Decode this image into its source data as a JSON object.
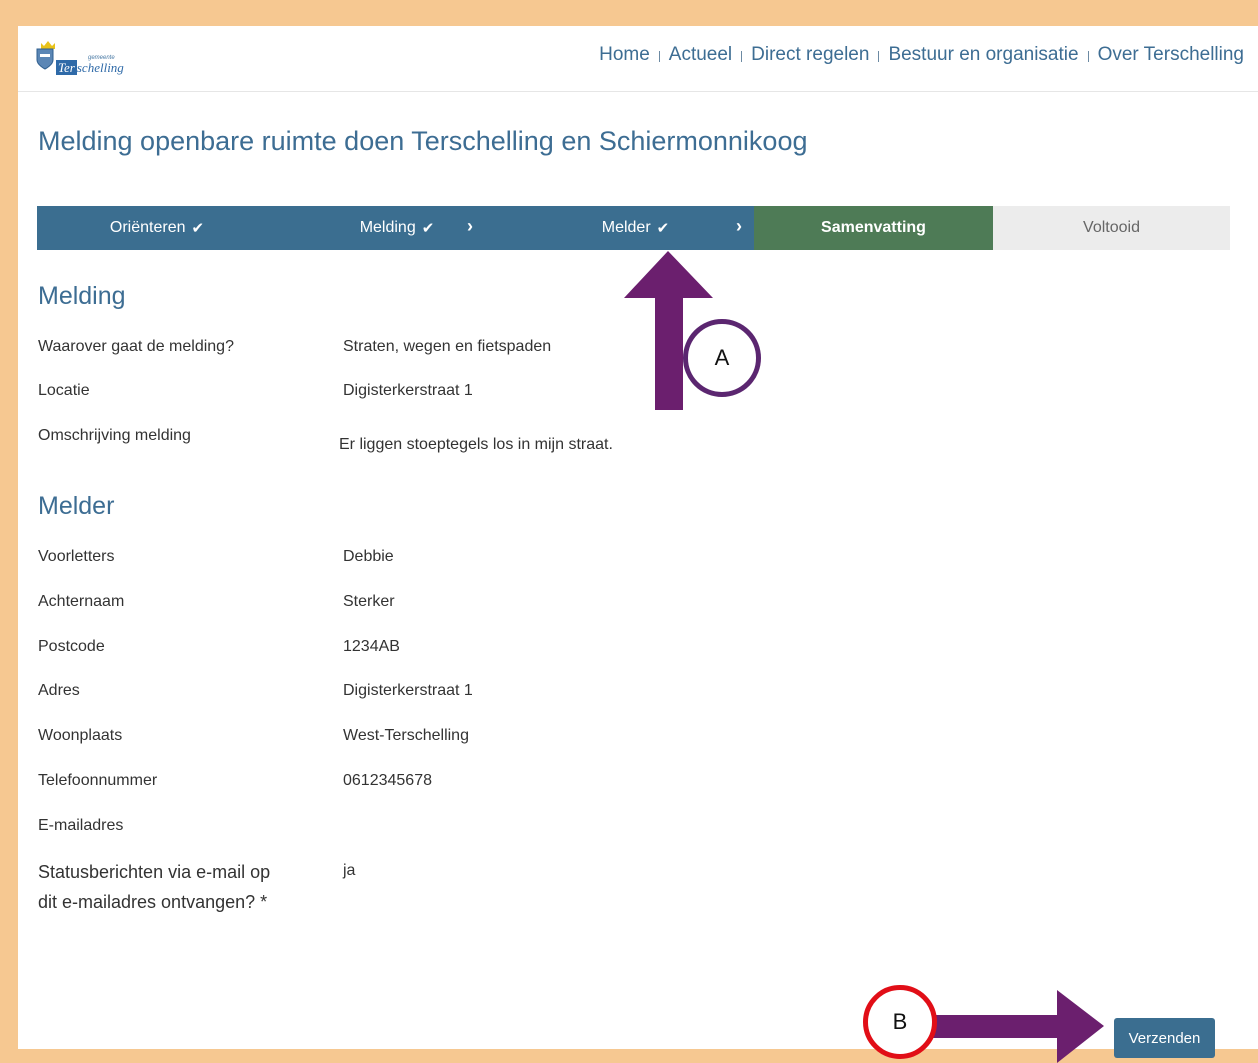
{
  "header": {
    "logo_small_text": "gemeente",
    "logo_ter": "Ter",
    "logo_rest": "schelling",
    "nav": [
      {
        "label": "Home"
      },
      {
        "label": "Actueel"
      },
      {
        "label": "Direct regelen"
      },
      {
        "label": "Bestuur en organisatie"
      },
      {
        "label": "Over Terschelling"
      }
    ]
  },
  "page_title": "Melding openbare ruimte doen Terschelling en Schiermonnikoog",
  "steps": [
    {
      "label": "Oriënteren",
      "state": "done",
      "check_icon": "✔"
    },
    {
      "label": "Melding",
      "state": "done",
      "check_icon": "✔",
      "chevron_icon": "›"
    },
    {
      "label": "Melder",
      "state": "done",
      "check_icon": "✔",
      "chevron_icon": "›"
    },
    {
      "label": "Samenvatting",
      "state": "active"
    },
    {
      "label": "Voltooid",
      "state": "todo"
    }
  ],
  "melding": {
    "title": "Melding",
    "rows": [
      {
        "label": "Waarover gaat de melding?",
        "value": "Straten, wegen en fietspaden"
      },
      {
        "label": "Locatie",
        "value": "Digisterkerstraat 1"
      },
      {
        "label": "Omschrijving melding",
        "value": "Er liggen stoeptegels los in mijn straat."
      }
    ]
  },
  "melder": {
    "title": "Melder",
    "rows": [
      {
        "label": "Voorletters",
        "value": "Debbie"
      },
      {
        "label": "Achternaam",
        "value": "Sterker"
      },
      {
        "label": "Postcode",
        "value": "1234AB"
      },
      {
        "label": "Adres",
        "value": "Digisterkerstraat 1"
      },
      {
        "label": "Woonplaats",
        "value": "West-Terschelling"
      },
      {
        "label": "Telefoonnummer",
        "value": "0612345678"
      },
      {
        "label": "E-mailadres",
        "value": ""
      },
      {
        "label_line1": "Statusberichten via e-mail op",
        "label_line2": "dit e-mailadres ontvangen? *",
        "value": "ja"
      }
    ]
  },
  "submit_label": "Verzenden",
  "annotations": {
    "a_label": "A",
    "b_label": "B",
    "arrow_color": "#6b1f6e",
    "circle_a_color": "#5b2670",
    "circle_b_color": "#e10e17"
  },
  "colors": {
    "frame": "#f6c891",
    "primary": "#3b6e90",
    "active_step": "#4e7b56",
    "todo_step": "#ececec"
  }
}
